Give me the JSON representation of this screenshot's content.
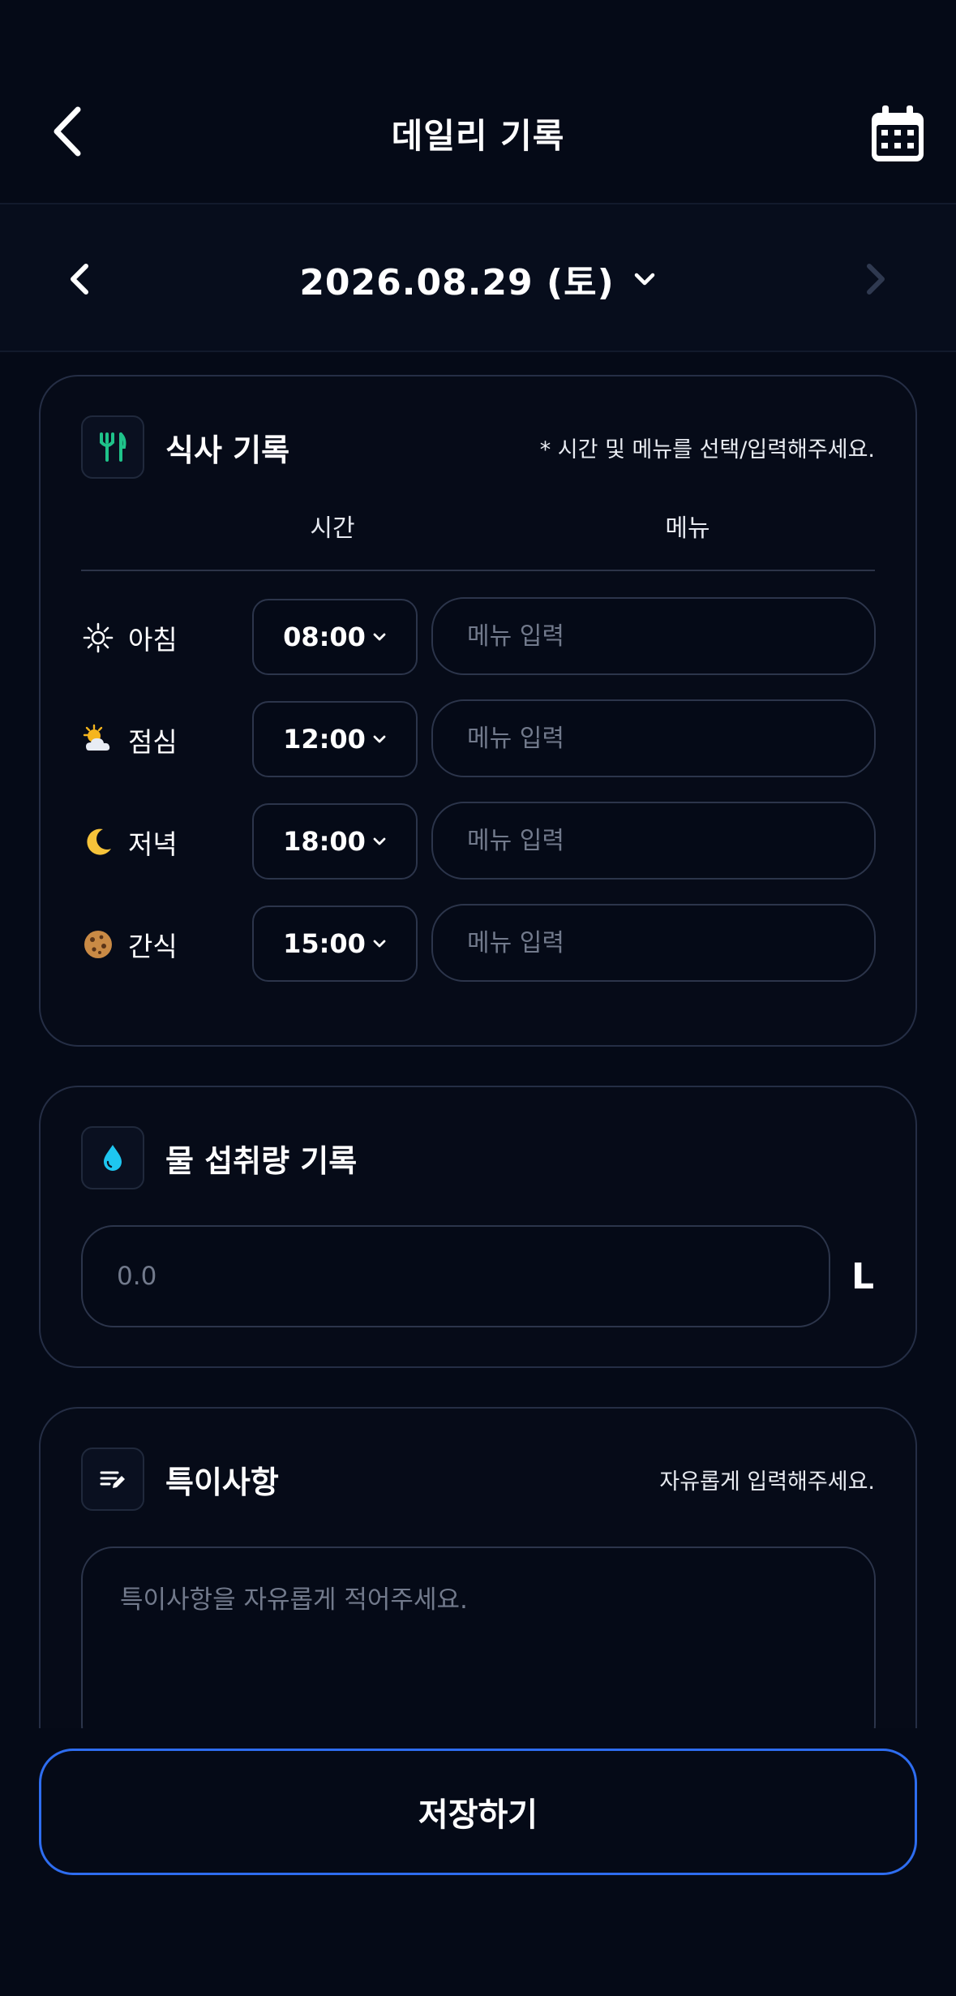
{
  "header": {
    "title": "데일리 기록",
    "back_icon": "chevron-left-icon",
    "calendar_icon": "calendar-icon"
  },
  "date_bar": {
    "date": "2026.08.29 (토)",
    "prev_icon": "chevron-left-icon",
    "next_icon": "chevron-right-icon",
    "dropdown_icon": "chevron-down-icon"
  },
  "meal": {
    "title": "식사 기록",
    "hint": "* 시간 및 메뉴를 선택/입력해주세요.",
    "icon": "utensils-icon",
    "accent": "#1fc38a",
    "columns": {
      "time": "시간",
      "menu": "메뉴"
    },
    "rows": [
      {
        "label": "아침",
        "emoji": "sun-icon",
        "time": "08:00",
        "menu_value": "",
        "menu_placeholder": "메뉴 입력"
      },
      {
        "label": "점심",
        "emoji": "sun-cloud-icon",
        "time": "12:00",
        "menu_value": "",
        "menu_placeholder": "메뉴 입력"
      },
      {
        "label": "저녁",
        "emoji": "moon-icon",
        "time": "18:00",
        "menu_value": "",
        "menu_placeholder": "메뉴 입력"
      },
      {
        "label": "간식",
        "emoji": "cookie-icon",
        "time": "15:00",
        "menu_value": "",
        "menu_placeholder": "메뉴 입력"
      }
    ]
  },
  "water": {
    "title": "물 섭취량 기록",
    "icon": "water-drop-icon",
    "accent": "#1ec6f0",
    "value": "",
    "placeholder": "0.0",
    "unit": "L"
  },
  "notes": {
    "title": "특이사항",
    "hint": "자유롭게 입력해주세요.",
    "icon": "edit-note-icon",
    "value": "",
    "placeholder": "특이사항을 자유롭게 적어주세요."
  },
  "save": {
    "label": "저장하기",
    "border_color": "#2e6df0"
  }
}
